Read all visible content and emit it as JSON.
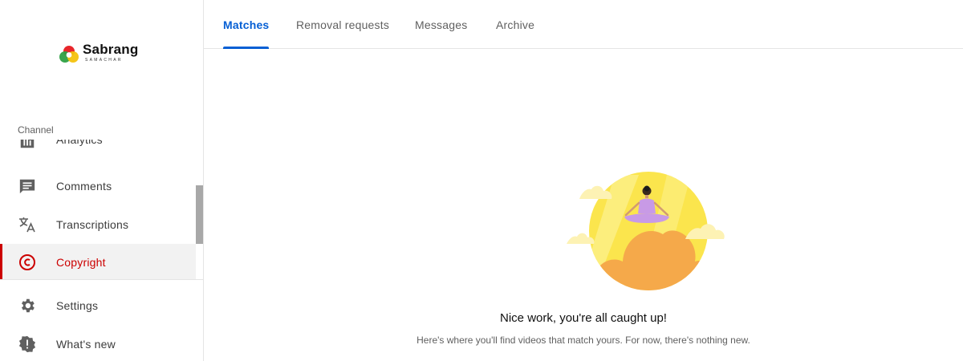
{
  "brand": {
    "name": "Sabrang",
    "subtitle": "SAMACHAR"
  },
  "sidebar": {
    "section_label": "Channel",
    "items": [
      {
        "label": "Analytics",
        "icon": "analytics-icon"
      },
      {
        "label": "Comments",
        "icon": "comments-icon"
      },
      {
        "label": "Transcriptions",
        "icon": "transcriptions-icon"
      },
      {
        "label": "Copyright",
        "icon": "copyright-icon",
        "active": true
      },
      {
        "label": "Settings",
        "icon": "gear-icon"
      },
      {
        "label": "What's new",
        "icon": "alert-icon"
      }
    ]
  },
  "tabs": [
    {
      "label": "Matches",
      "active": true
    },
    {
      "label": "Removal requests"
    },
    {
      "label": "Messages"
    },
    {
      "label": "Archive"
    }
  ],
  "empty_state": {
    "title": "Nice work, you're all caught up!",
    "subtitle": "Here's where you'll find videos that match yours. For now, there's nothing new."
  },
  "colors": {
    "accent": "#065fd4",
    "active_nav": "#cc0000",
    "illustration_yellow": "#fbe54d",
    "illustration_orange": "#f5a94a",
    "illustration_figure": "#c89ae6"
  }
}
